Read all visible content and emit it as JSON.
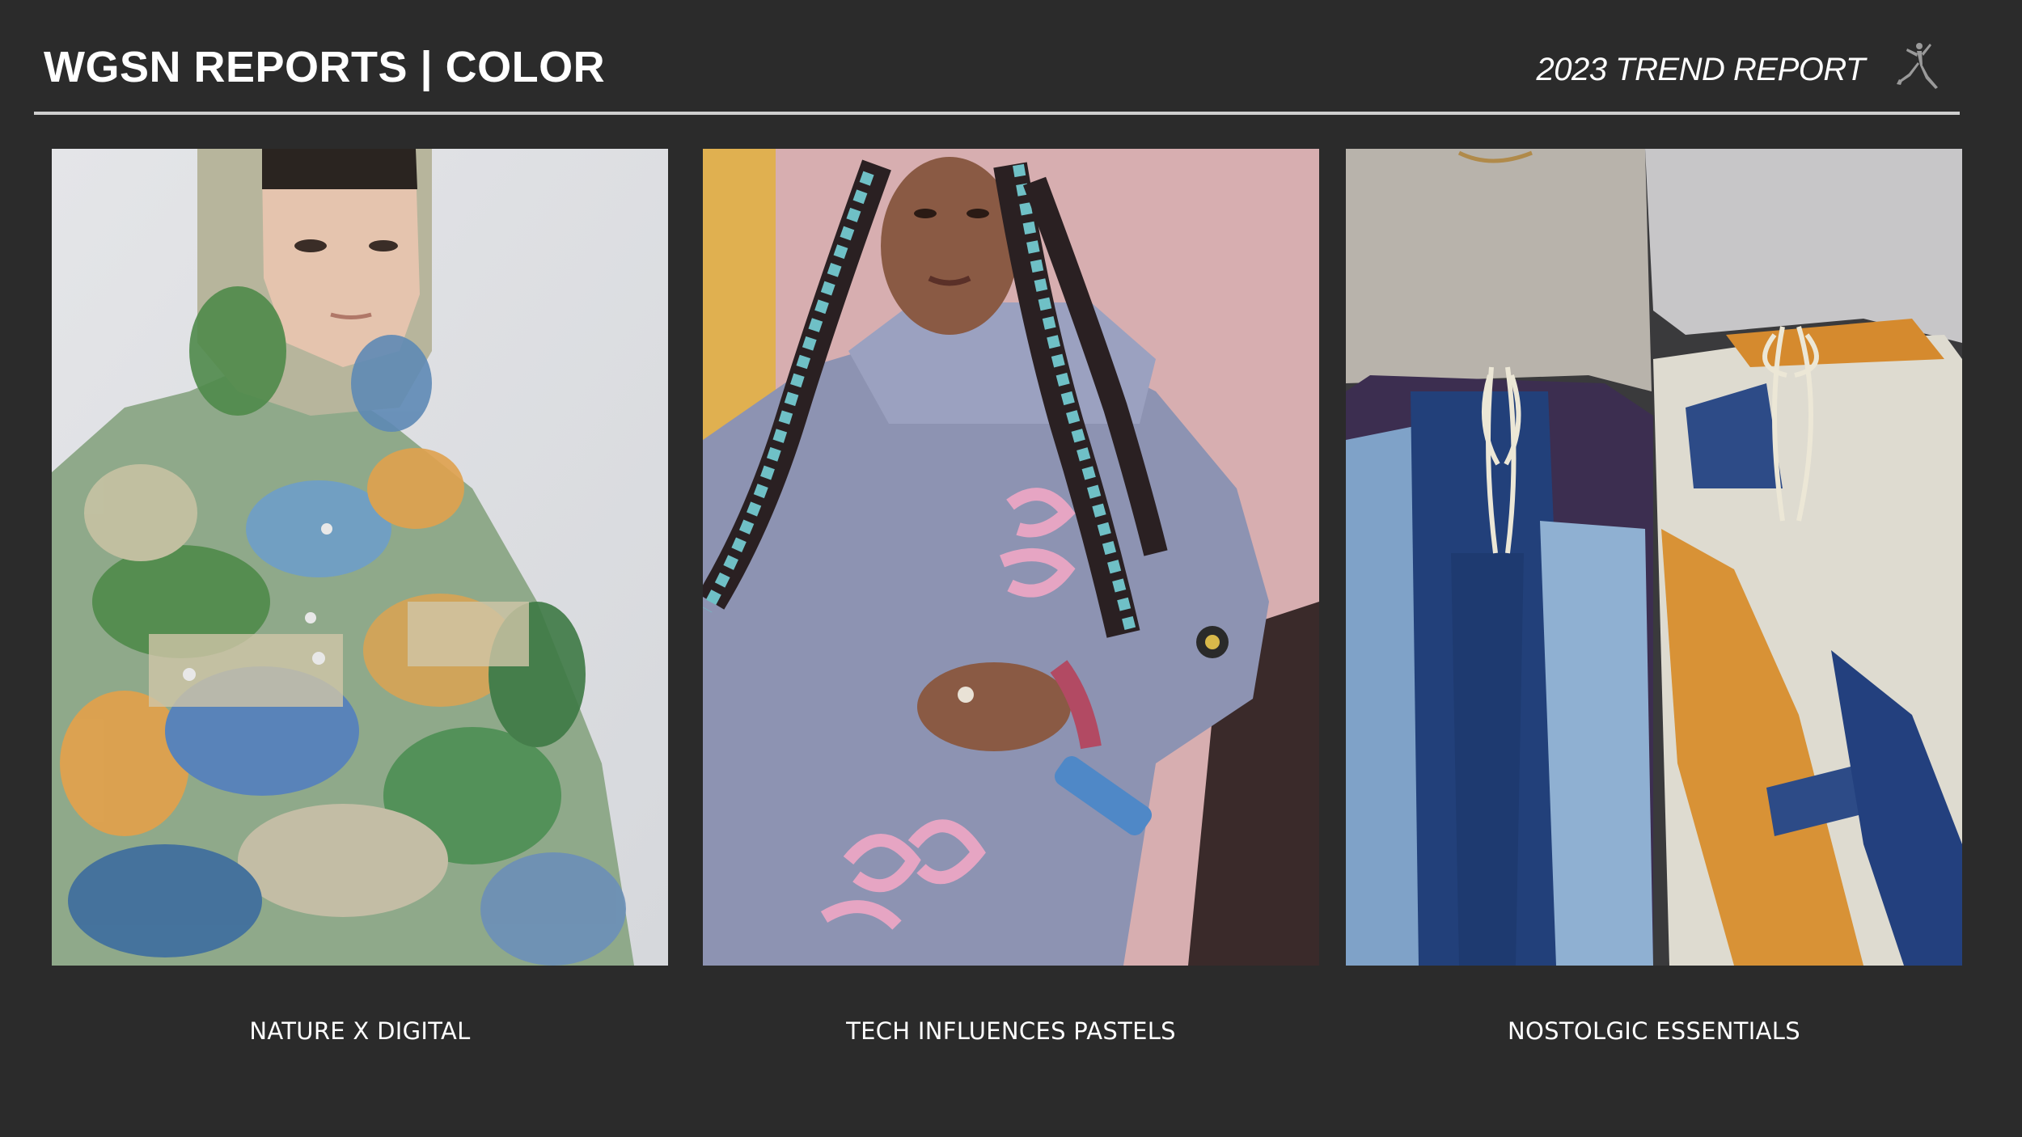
{
  "header": {
    "title": "WGSN REPORTS | COLOR",
    "report_label": "2023 TREND REPORT",
    "logo_icon": "jumpman-logo-icon"
  },
  "panels": [
    {
      "caption": "NATURE X DIGITAL",
      "photo": "model-in-landscape-print-hooded-jacket"
    },
    {
      "caption": "TECH INFLUENCES PASTELS",
      "photo": "model-in-lavender-hoodie-with-teal-braids"
    },
    {
      "caption": "NOSTOLGIC ESSENTIALS",
      "photo": "two-models-in-colorblock-drawstring-pants"
    }
  ],
  "colors": {
    "background": "#2b2b2b",
    "text": "#ffffff",
    "rule": "#cfcfcf"
  }
}
